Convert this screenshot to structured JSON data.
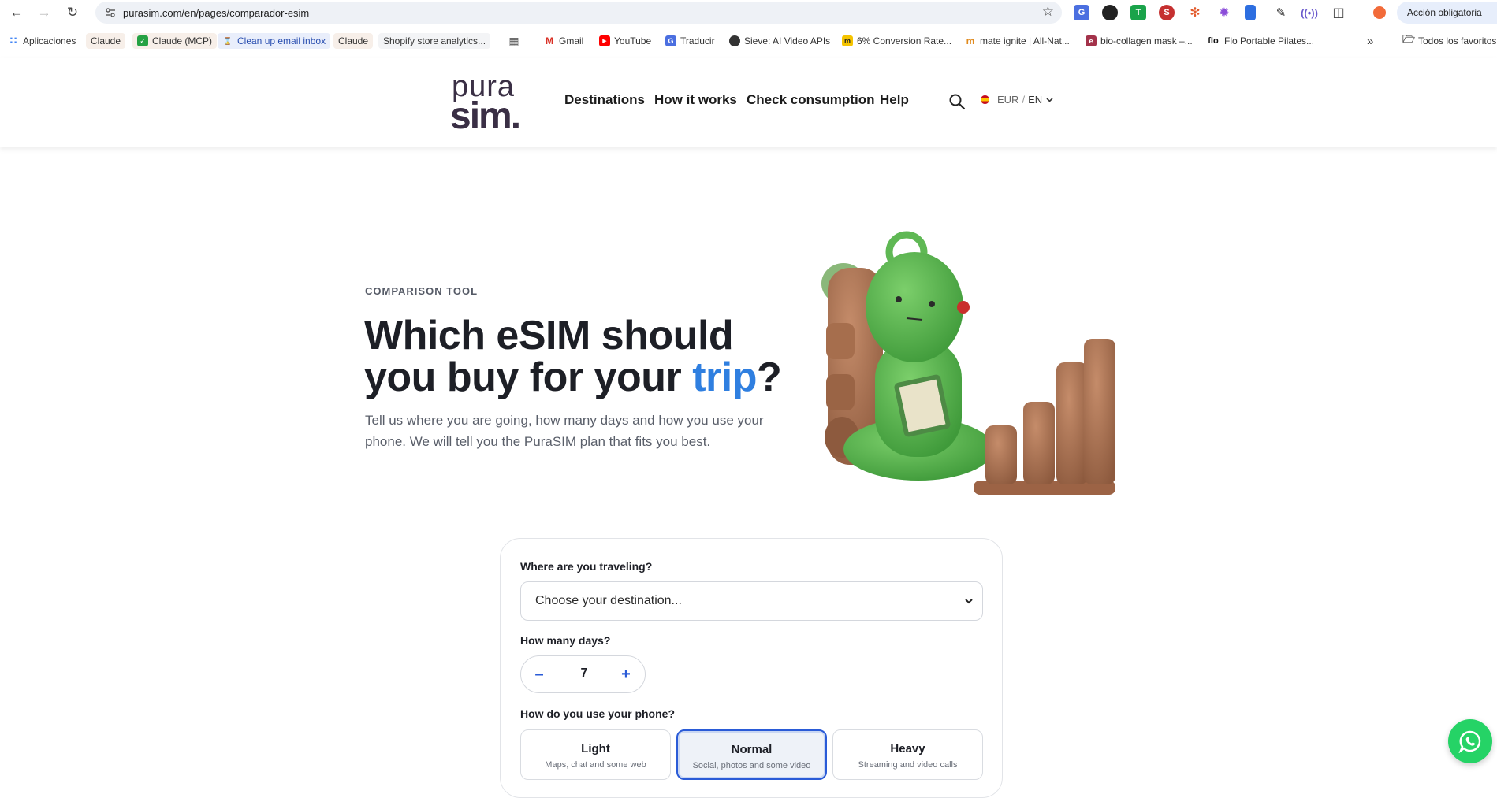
{
  "browser": {
    "url": "purasim.com/en/pages/comparador-esim",
    "action_label": "Acción obligatoria",
    "bookmarks": [
      {
        "label": "Aplicaciones"
      },
      {
        "label": "Claude"
      },
      {
        "label": "Claude (MCP)"
      },
      {
        "label": "Clean up email inbox"
      },
      {
        "label": "Claude"
      },
      {
        "label": "Shopify store analytics..."
      },
      {
        "label": "Gmail"
      },
      {
        "label": "YouTube"
      },
      {
        "label": "Traducir"
      },
      {
        "label": "Sieve: AI Video APIs"
      },
      {
        "label": "6% Conversion Rate..."
      },
      {
        "label": "mate ignite | All-Nat..."
      },
      {
        "label": "bio-collagen mask –..."
      },
      {
        "label": "Flo Portable Pilates..."
      }
    ],
    "more_label": "»",
    "all_bookmarks": "Todos los favoritos"
  },
  "site": {
    "logo_top": "pura",
    "logo_bottom": "sim.",
    "nav": [
      "Destinations",
      "How it works",
      "Check consumption",
      "Help"
    ],
    "currency": "EUR",
    "separator": "/",
    "language": "EN"
  },
  "hero": {
    "eyebrow": "COMPARISON TOOL",
    "title_part1": "Which eSIM should you buy for your ",
    "title_accent": "trip",
    "title_part2": "?",
    "subtitle": "Tell us where you are going, how many days and how you use your phone. We will tell you the PuraSIM plan that fits you best."
  },
  "form": {
    "destination_label": "Where are you traveling?",
    "destination_value": "Choose your destination...",
    "days_label": "How many days?",
    "days_value": "7",
    "minus": "–",
    "plus": "+",
    "usage_label": "How do you use your phone?",
    "usage_options": [
      {
        "title": "Light",
        "desc": "Maps, chat and some web"
      },
      {
        "title": "Normal",
        "desc": "Social, photos and some video"
      },
      {
        "title": "Heavy",
        "desc": "Streaming and video calls"
      }
    ],
    "selected_usage": "Normal"
  },
  "colors": {
    "accent": "#2f7fe0",
    "selected_border": "#2a5bd7",
    "whatsapp": "#25d366"
  }
}
